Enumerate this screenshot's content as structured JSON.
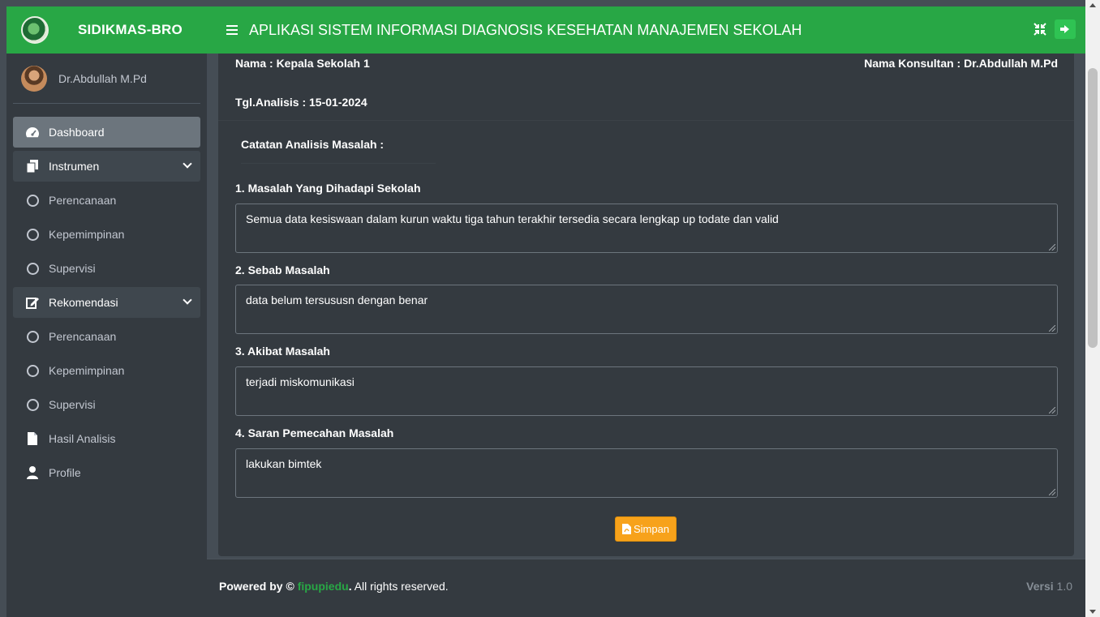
{
  "brand": {
    "name": "SIDIKMAS-BRO"
  },
  "user": {
    "name": "Dr.Abdullah M.Pd"
  },
  "sidebar": {
    "items": [
      {
        "label": "Dashboard"
      },
      {
        "label": "Instrumen"
      },
      {
        "label": "Perencanaan"
      },
      {
        "label": "Kepemimpinan"
      },
      {
        "label": "Supervisi"
      },
      {
        "label": "Rekomendasi"
      },
      {
        "label": "Perencanaan"
      },
      {
        "label": "Kepemimpinan"
      },
      {
        "label": "Supervisi"
      },
      {
        "label": "Hasil Analisis"
      },
      {
        "label": "Profile"
      }
    ]
  },
  "header": {
    "title": "APLIKASI SISTEM INFORMASI DIAGNOSIS KESEHATAN MANAJEMEN SEKOLAH"
  },
  "info": {
    "nama": "Nama : Kepala Sekolah 1",
    "konsultan": "Nama Konsultan : Dr.Abdullah M.Pd",
    "tgl": "Tgl.Analisis : 15-01-2024"
  },
  "notes": {
    "title": "Catatan Analisis Masalah :",
    "fields": [
      {
        "label": "1. Masalah Yang Dihadapi Sekolah",
        "value": "Semua data kesiswaan dalam kurun waktu tiga tahun terakhir tersedia secara lengkap up todate dan valid"
      },
      {
        "label": "2. Sebab Masalah",
        "value": "data belum tersususn dengan benar"
      },
      {
        "label": "3. Akibat Masalah",
        "value": "terjadi miskomunikasi"
      },
      {
        "label": "4. Saran Pemecahan Masalah",
        "value": "lakukan bimtek"
      }
    ],
    "save_label": "Simpan"
  },
  "footer": {
    "prefix": "Powered by ©",
    "link": "fipupiedu",
    "suffix": ". All rights reserved.",
    "version_label": "Versi",
    "version": "1.0"
  },
  "colors": {
    "header": "#28a745",
    "sidebar": "#343a40",
    "content": "#454d55",
    "save": "#f7a21b"
  }
}
